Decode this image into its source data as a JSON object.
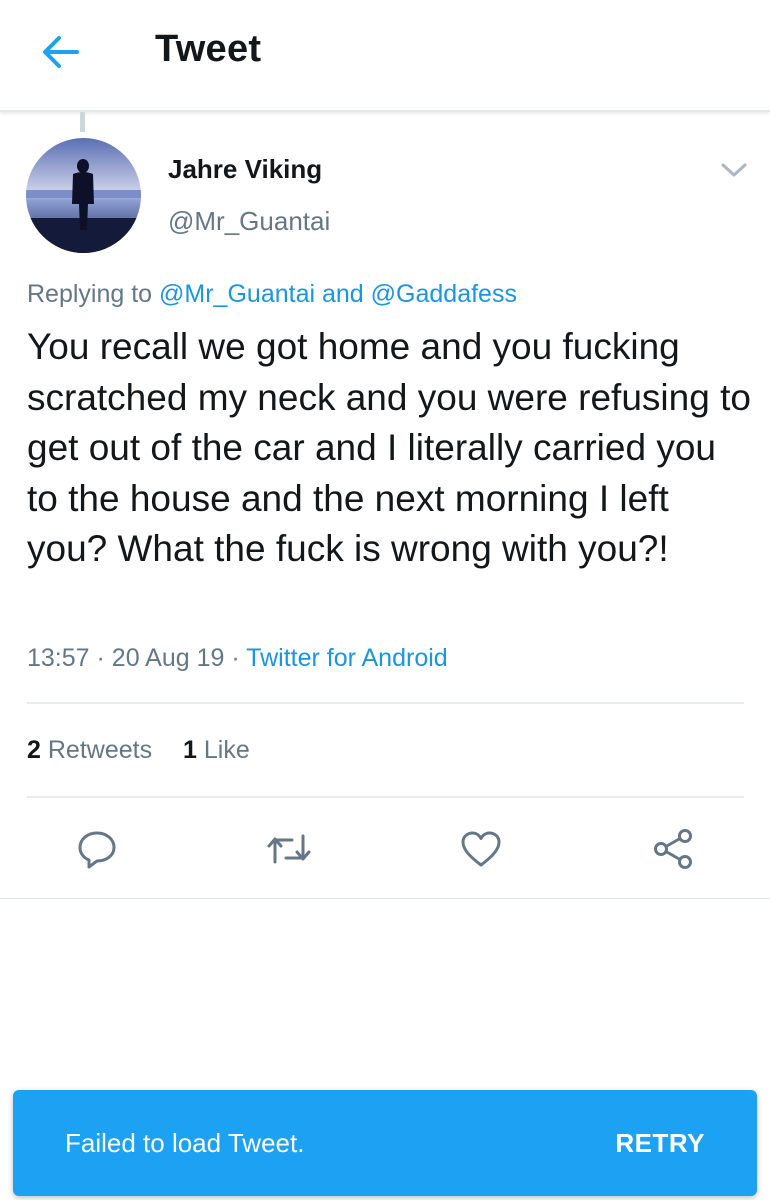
{
  "header": {
    "title": "Tweet",
    "back_icon": "arrow-left-icon"
  },
  "tweet": {
    "author_name": "Jahre Viking",
    "author_handle": "@Mr_Guantai",
    "replying_prefix": "Replying to",
    "replying_mention_1": "@Mr_Guantai",
    "replying_and": "and",
    "replying_mention_2": "@Gaddafess",
    "text": "You recall we got home and you fucking scratched my neck and you were refusing to get out of the car and I literally carried you to the house and the next morning I left you? What the fuck is wrong with you?!",
    "time": "13:57",
    "date": "20 Aug 19",
    "source": "Twitter for Android",
    "separator": "·"
  },
  "stats": {
    "retweets_count": "2",
    "retweets_label": "Retweets",
    "likes_count": "1",
    "likes_label": "Like"
  },
  "actions": [
    "reply-icon",
    "retweet-icon",
    "like-icon",
    "share-icon"
  ],
  "snackbar": {
    "message": "Failed to load Tweet.",
    "action": "RETRY"
  },
  "colors": {
    "accent": "#1da1f2",
    "link": "#1b95e0",
    "secondary_text": "#657786",
    "primary_text": "#14171a"
  }
}
